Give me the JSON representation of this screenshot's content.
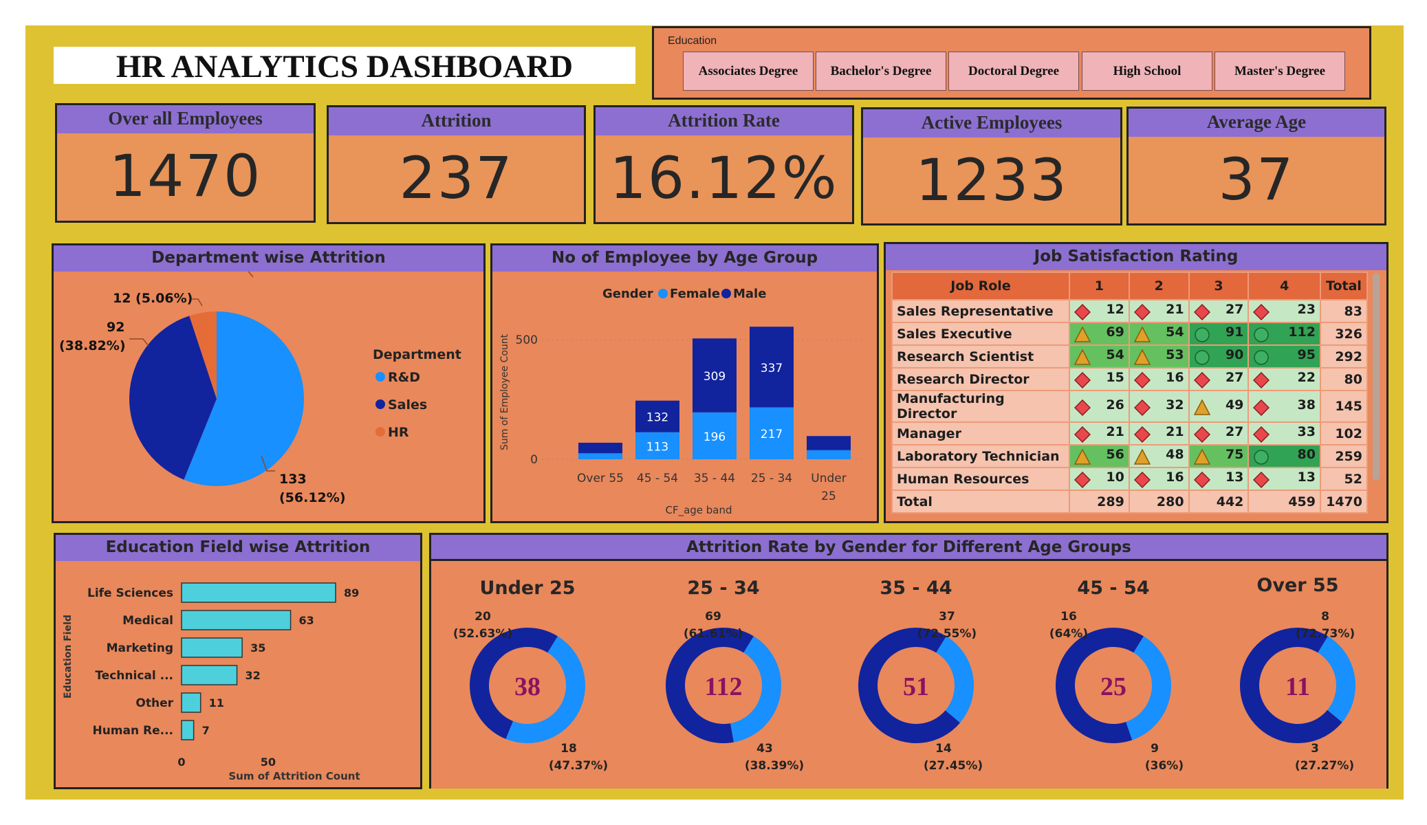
{
  "dashboard": {
    "title": "HR ANALYTICS DASHBOARD"
  },
  "slicer": {
    "label": "Education",
    "options": [
      "Associates Degree",
      "Bachelor's Degree",
      "Doctoral Degree",
      "High School",
      "Master's Degree"
    ]
  },
  "kpis": [
    {
      "title": "Over all Employees",
      "value": "1470"
    },
    {
      "title": "Attrition",
      "value": "237"
    },
    {
      "title": "Attrition Rate",
      "value": "16.12%"
    },
    {
      "title": "Active Employees",
      "value": "1233"
    },
    {
      "title": "Average Age",
      "value": "37"
    }
  ],
  "colors": {
    "background": "#dfc232",
    "panel": "#e9885b",
    "header": "#8d6fd1",
    "rd": "#1890ff",
    "sales": "#12239e",
    "hr": "#e66c37",
    "female": "#1890ff",
    "male": "#12239e",
    "bar": "#4dd0dc"
  },
  "dept_attrition": {
    "title": "Department wise Attrition",
    "legend_title": "Department",
    "label_hr": "12 (5.06%)",
    "label_sales_1": "92",
    "label_sales_2": "(38.82%)",
    "label_rd_1": "133",
    "label_rd_2": "(56.12%)"
  },
  "age_group": {
    "title": "No of Employee by Age Group",
    "legend_title": "Gender",
    "xlabel": "CF_age band",
    "ylabel": "Sum of Employee Count"
  },
  "job_satisfaction": {
    "title": "Job Satisfaction Rating",
    "headers": [
      "Job Role",
      "1",
      "2",
      "3",
      "4",
      "Total"
    ],
    "rows": [
      {
        "role": "Sales Representative",
        "v": [
          "12",
          "21",
          "27",
          "23"
        ],
        "total": "83",
        "lvl": [
          "l",
          "l",
          "l",
          "l"
        ],
        "ico": [
          "d",
          "d",
          "d",
          "d"
        ]
      },
      {
        "role": "Sales Executive",
        "v": [
          "69",
          "54",
          "91",
          "112"
        ],
        "total": "326",
        "lvl": [
          "m",
          "m",
          "h",
          "h"
        ],
        "ico": [
          "t",
          "t",
          "c",
          "c"
        ]
      },
      {
        "role": "Research Scientist",
        "v": [
          "54",
          "53",
          "90",
          "95"
        ],
        "total": "292",
        "lvl": [
          "m",
          "m",
          "h",
          "h"
        ],
        "ico": [
          "t",
          "t",
          "c",
          "c"
        ]
      },
      {
        "role": "Research Director",
        "v": [
          "15",
          "16",
          "27",
          "22"
        ],
        "total": "80",
        "lvl": [
          "l",
          "l",
          "l",
          "l"
        ],
        "ico": [
          "d",
          "d",
          "d",
          "d"
        ]
      },
      {
        "role": "Manufacturing Director",
        "v": [
          "26",
          "32",
          "49",
          "38"
        ],
        "total": "145",
        "lvl": [
          "l",
          "l",
          "l",
          "l"
        ],
        "ico": [
          "d",
          "d",
          "t",
          "d"
        ]
      },
      {
        "role": "Manager",
        "v": [
          "21",
          "21",
          "27",
          "33"
        ],
        "total": "102",
        "lvl": [
          "l",
          "l",
          "l",
          "l"
        ],
        "ico": [
          "d",
          "d",
          "d",
          "d"
        ]
      },
      {
        "role": "Laboratory Technician",
        "v": [
          "56",
          "48",
          "75",
          "80"
        ],
        "total": "259",
        "lvl": [
          "m",
          "l",
          "m",
          "h"
        ],
        "ico": [
          "t",
          "t",
          "t",
          "c"
        ]
      },
      {
        "role": "Human Resources",
        "v": [
          "10",
          "16",
          "13",
          "13"
        ],
        "total": "52",
        "lvl": [
          "l",
          "l",
          "l",
          "l"
        ],
        "ico": [
          "d",
          "d",
          "d",
          "d"
        ]
      }
    ],
    "totals": {
      "label": "Total",
      "v": [
        "289",
        "280",
        "442",
        "459"
      ],
      "total": "1470"
    }
  },
  "edu_field": {
    "title": "Education Field wise Attrition",
    "ylabel": "Education Field",
    "xlabel": "Sum of Attrition Count"
  },
  "donuts": {
    "title": "Attrition Rate by Gender for Different Age Groups",
    "items": [
      {
        "label": "Under 25",
        "center": "38",
        "male": 20,
        "female": 18,
        "male_pct": "(52.63%)",
        "female_pct": "(47.37%)"
      },
      {
        "label": "25 - 34",
        "center": "112",
        "male": 69,
        "female": 43,
        "male_pct": "(61.61%)",
        "female_pct": "(38.39%)"
      },
      {
        "label": "35 - 44",
        "center": "51",
        "male": 37,
        "female": 14,
        "male_pct": "(72.55%)",
        "female_pct": "(27.45%)"
      },
      {
        "label": "45 - 54",
        "center": "25",
        "male": 16,
        "female": 9,
        "male_pct": "(64%)",
        "female_pct": "(36%)"
      },
      {
        "label": "Over 55",
        "center": "11",
        "male": 8,
        "female": 3,
        "male_pct": "(72.73%)",
        "female_pct": "(27.27%)"
      }
    ]
  },
  "chart_data": [
    {
      "type": "pie",
      "title": "Department wise Attrition",
      "categories": [
        "R&D",
        "Sales",
        "HR"
      ],
      "values": [
        133,
        92,
        12
      ]
    },
    {
      "type": "bar",
      "title": "No of Employee by Age Group",
      "categories": [
        "Over 55",
        "45 - 54",
        "35 - 44",
        "25 - 34",
        "Under 25"
      ],
      "series": [
        {
          "name": "Female",
          "values": [
            25,
            113,
            196,
            217,
            38
          ]
        },
        {
          "name": "Male",
          "values": [
            44,
            132,
            309,
            337,
            59
          ]
        }
      ],
      "xlabel": "CF_age band",
      "ylabel": "Sum of Employee Count",
      "yticks": [
        0,
        500
      ],
      "ylim": [
        0,
        600
      ]
    },
    {
      "type": "bar",
      "title": "Education Field wise Attrition",
      "categories": [
        "Life Sciences",
        "Medical",
        "Marketing",
        "Technical ...",
        "Other",
        "Human Re..."
      ],
      "values": [
        89,
        63,
        35,
        32,
        11,
        7
      ],
      "xlabel": "Sum of Attrition Count",
      "ylabel": "Education Field",
      "xticks": [
        0,
        50
      ]
    }
  ]
}
